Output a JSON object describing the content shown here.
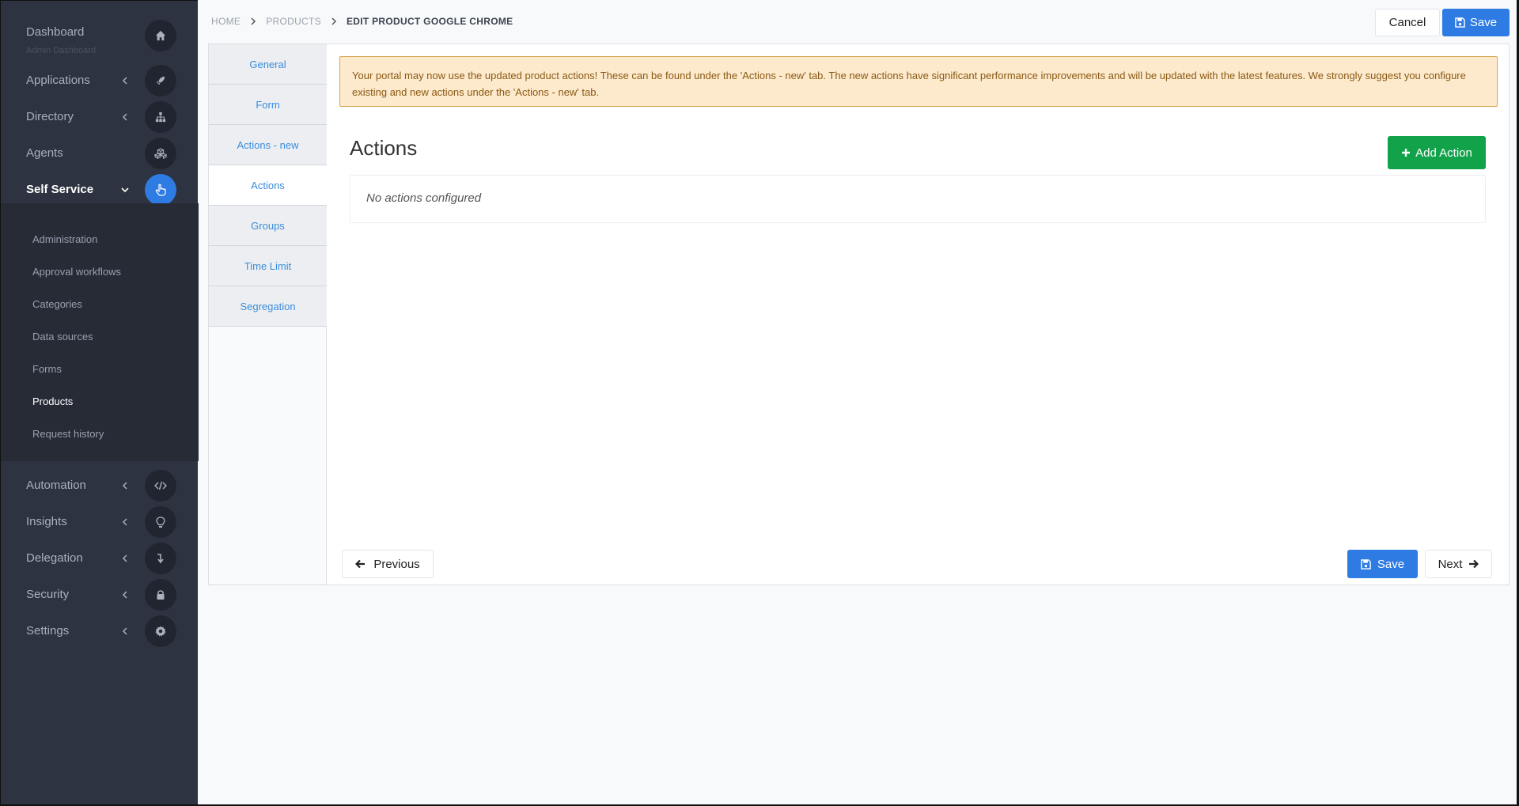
{
  "sidebar": {
    "dashboard": {
      "label": "Dashboard",
      "subtitle": "Admin Dashboard",
      "icon": "home-icon"
    },
    "applications": {
      "label": "Applications",
      "icon": "rocket-icon"
    },
    "directory": {
      "label": "Directory",
      "icon": "sitemap-icon"
    },
    "agents": {
      "label": "Agents",
      "icon": "cubes-icon"
    },
    "self_service": {
      "label": "Self Service",
      "icon": "hand-pointer-icon"
    },
    "self_service_items": [
      {
        "label": "Administration"
      },
      {
        "label": "Approval workflows"
      },
      {
        "label": "Categories"
      },
      {
        "label": "Data sources"
      },
      {
        "label": "Forms"
      },
      {
        "label": "Products",
        "active": true
      },
      {
        "label": "Request history"
      }
    ],
    "automation": {
      "label": "Automation",
      "icon": "code-icon"
    },
    "insights": {
      "label": "Insights",
      "icon": "lightbulb-icon"
    },
    "delegation": {
      "label": "Delegation",
      "icon": "level-down-icon"
    },
    "security": {
      "label": "Security",
      "icon": "lock-icon"
    },
    "settings": {
      "label": "Settings",
      "icon": "gear-icon"
    }
  },
  "breadcrumb": {
    "home": "HOME",
    "products": "PRODUCTS",
    "current": "EDIT PRODUCT GOOGLE CHROME"
  },
  "toolbar": {
    "cancel_label": "Cancel",
    "save_label": "Save"
  },
  "tabs": [
    {
      "label": "General"
    },
    {
      "label": "Form"
    },
    {
      "label": "Actions - new"
    },
    {
      "label": "Actions",
      "active": true
    },
    {
      "label": "Groups"
    },
    {
      "label": "Time Limit"
    },
    {
      "label": "Segregation"
    }
  ],
  "alert": {
    "line1": "Your portal may now use the updated product actions! These can be found under the 'Actions - new' tab. The new actions have significant performance improvements and will be updated with the latest features. We strongly suggest you configure",
    "line2": "existing and new actions under the 'Actions - new' tab."
  },
  "actions": {
    "title": "Actions",
    "add_label": "Add Action",
    "empty_text": "No actions configured"
  },
  "footer": {
    "previous_label": "Previous",
    "save_label": "Save",
    "next_label": "Next"
  },
  "colors": {
    "sidebar_bg": "#2d3340",
    "accent_blue": "#2d7be3",
    "success_green": "#11a24a",
    "alert_bg": "#fde9cc",
    "alert_text": "#8a5a14"
  }
}
